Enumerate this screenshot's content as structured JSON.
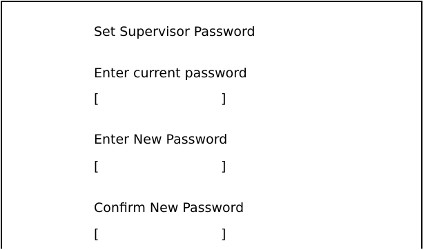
{
  "dialog": {
    "title": "Set Supervisor Password",
    "fields": [
      {
        "label": "Enter current password",
        "open_bracket": "[",
        "close_bracket": "]",
        "value": ""
      },
      {
        "label": "Enter New Password",
        "open_bracket": "[",
        "close_bracket": "]",
        "value": ""
      },
      {
        "label": "Confirm New Password",
        "open_bracket": "[",
        "close_bracket": "]",
        "value": ""
      }
    ]
  }
}
